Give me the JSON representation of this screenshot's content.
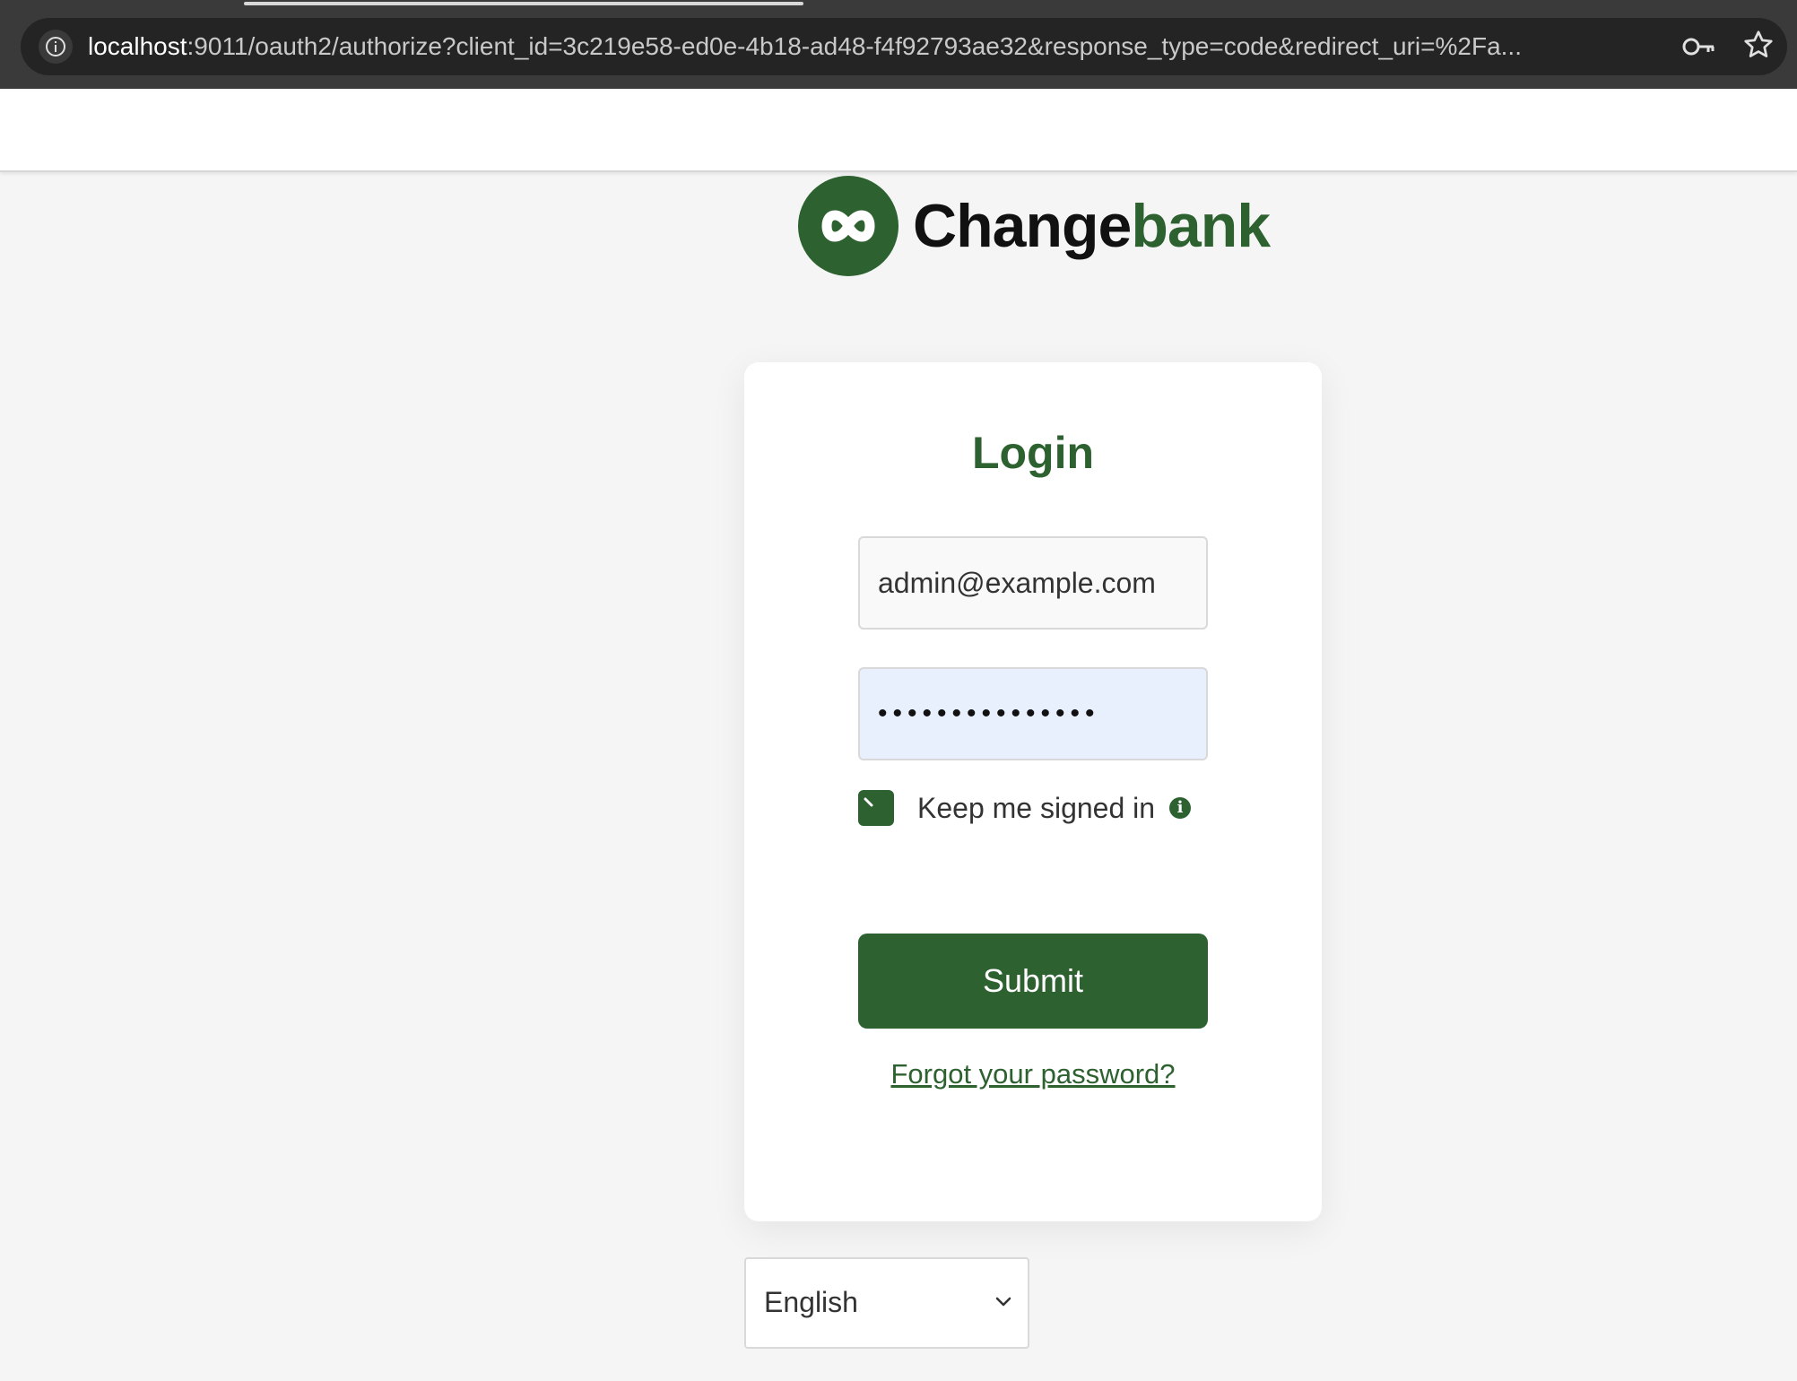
{
  "browser": {
    "url_host": "localhost",
    "url_rest": ":9011/oauth2/authorize?client_id=3c219e58-ed0e-4b18-ad48-f4f92793ae32&response_type=code&redirect_uri=%2Fa..."
  },
  "brand": {
    "name_part1": "Change",
    "name_part2": "bank",
    "accent_color": "#2d6230"
  },
  "login": {
    "title": "Login",
    "email_value": "admin@example.com",
    "password_mask": "•••••••••••••••",
    "keep_signed_in_label": "Keep me signed in",
    "keep_signed_in_checked": true,
    "info_glyph": "i",
    "submit_label": "Submit",
    "forgot_label": "Forgot your password?"
  },
  "language": {
    "selected": "English"
  },
  "icons": {
    "address_info": "info-icon",
    "saved_password": "key-icon",
    "bookmark": "star-icon",
    "checkbox": "check-icon",
    "select": "chevron-down-icon"
  }
}
